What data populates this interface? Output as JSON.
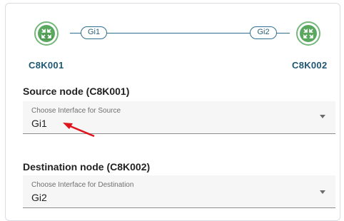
{
  "topology": {
    "source_node": "C8K001",
    "dest_node": "C8K002",
    "source_interface": "Gi1",
    "dest_interface": "Gi2",
    "router_icon": "router-icon",
    "router_color": "#76b77b"
  },
  "source": {
    "title": "Source node (C8K001)",
    "field_label": "Choose Interface for Source",
    "value": "Gi1"
  },
  "destination": {
    "title": "Destination node (C8K002)",
    "field_label": "Choose Interface for Destination",
    "value": "Gi2"
  },
  "annotation": {
    "arrow_color": "#e0141e"
  }
}
